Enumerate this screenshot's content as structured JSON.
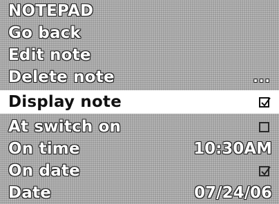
{
  "menu": {
    "title": "NOTEPAD",
    "items": [
      {
        "label": "Go back"
      },
      {
        "label": "Edit note"
      },
      {
        "label": "Delete note",
        "indicator": "..."
      },
      {
        "label": "Display note",
        "checked": true,
        "selected": true
      },
      {
        "label": "At switch on",
        "checked": false
      },
      {
        "label": "On time",
        "value": "10:30AM"
      },
      {
        "label": "On date",
        "checked": true
      },
      {
        "label": "Date",
        "value": "07/24/06"
      }
    ]
  },
  "icons": {
    "checkmark": "checkmark-icon"
  },
  "colors": {
    "screen_bg": "#a9a9a9",
    "selected_bg": "#ffffff",
    "text": "#ffffff",
    "text_outline": "#222222",
    "selected_text": "#111111"
  }
}
